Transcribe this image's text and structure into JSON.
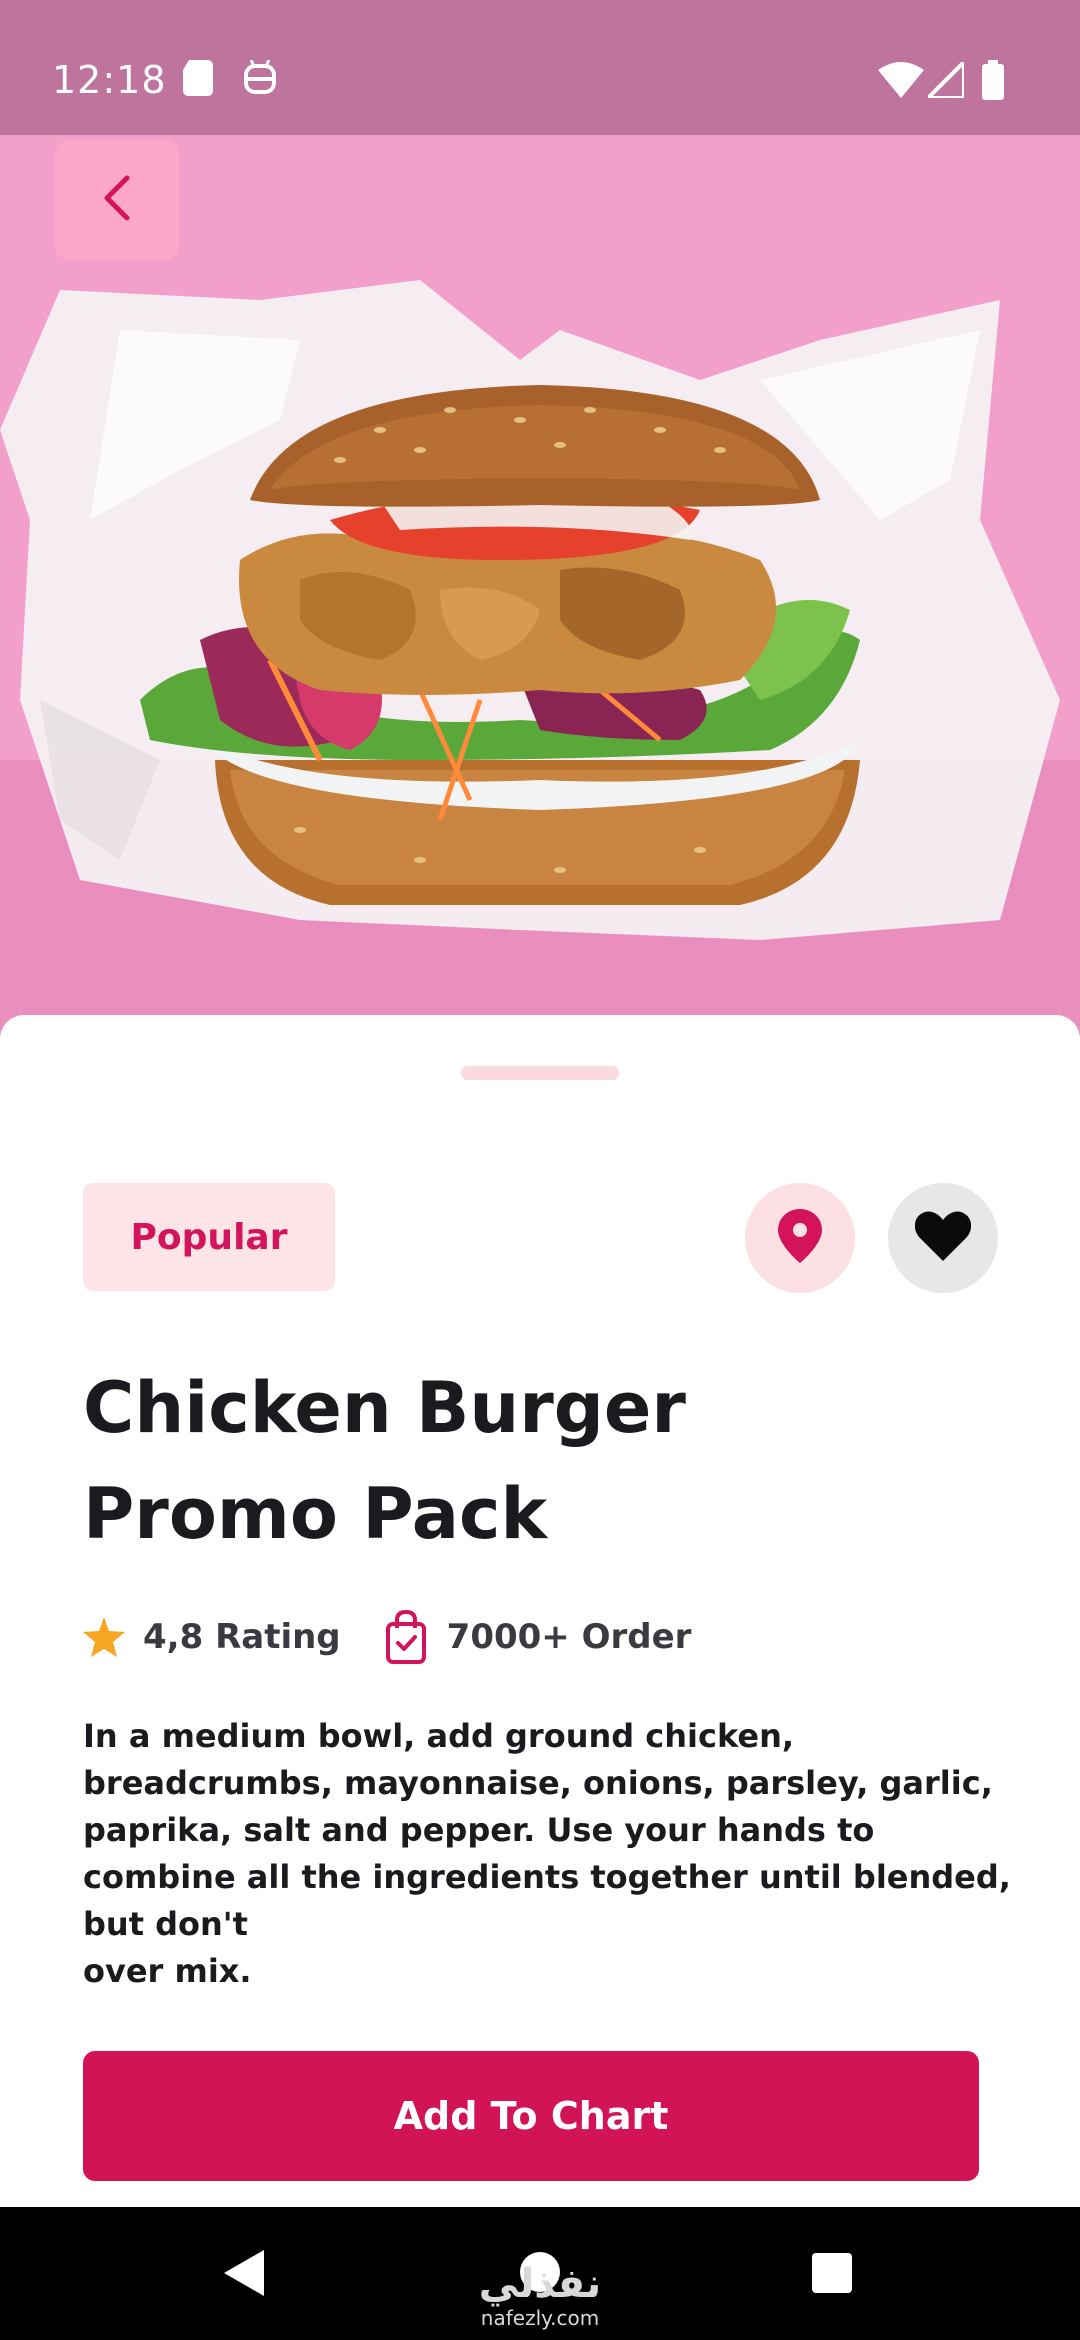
{
  "status_bar": {
    "time": "12:18",
    "icons": [
      "sd-card-icon",
      "android-debug-icon",
      "wifi-icon",
      "signal-icon",
      "battery-icon"
    ]
  },
  "hero": {
    "image": "chicken-burger-photo",
    "back_icon": "chevron-left-icon"
  },
  "product": {
    "badge": "Popular",
    "title_line1": "Chicken Burger",
    "title_line2": "Promo Pack",
    "rating_text": "4,8 Rating",
    "orders_text": "7000+ Order",
    "description_lines": [
      "In a medium bowl, add ground chicken,",
      "breadcrumbs, mayonnaise, onions, parsley, garlic,",
      "paprika, salt and pepper. Use your hands to",
      "combine all the ingredients together until blended,",
      "but don't",
      "over mix."
    ],
    "location_icon": "map-pin-icon",
    "favorite_icon": "heart-icon",
    "rating_icon": "star-icon",
    "orders_icon": "shopping-bag-check-icon"
  },
  "cta": {
    "label": "Add To Chart"
  },
  "nav_bar": {
    "icons": [
      "back-triangle-icon",
      "home-circle-icon",
      "recents-square-icon"
    ]
  },
  "watermark": {
    "arabic": "نفذلي",
    "latin": "nafezly.com"
  },
  "colors": {
    "accent": "#d21456",
    "badge_bg": "#fde4e7",
    "hero_pink": "#f39ac6",
    "star": "#f5a623"
  }
}
